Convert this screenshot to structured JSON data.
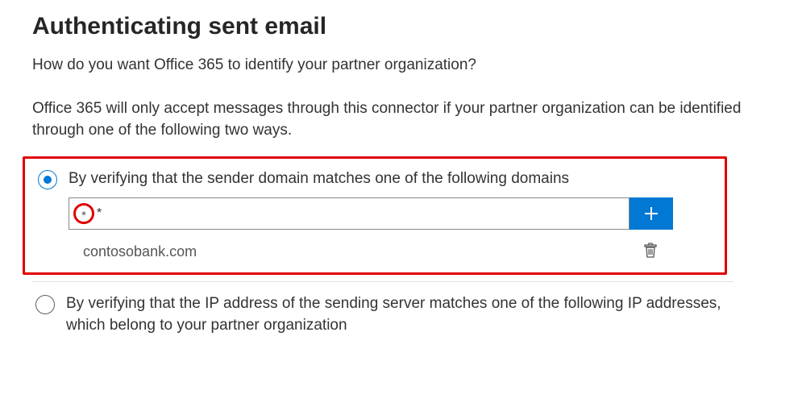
{
  "title": "Authenticating sent email",
  "lead": "How do you want Office 365 to identify your partner organization?",
  "description": "Office 365 will only accept messages through this connector if your partner organization can be identified through one of the following two ways.",
  "options": {
    "domain": {
      "selected": true,
      "label": "By verifying that the sender domain matches one of the following domains",
      "input_value": "*",
      "domains": [
        "contosobank.com"
      ]
    },
    "ip": {
      "selected": false,
      "label": "By verifying that the IP address of the sending server matches one of the following IP addresses, which belong to your partner organization"
    }
  },
  "icons": {
    "add": "plus-icon",
    "delete": "trash-icon"
  },
  "colors": {
    "accent": "#0078d4",
    "annotation": "#e00000"
  }
}
